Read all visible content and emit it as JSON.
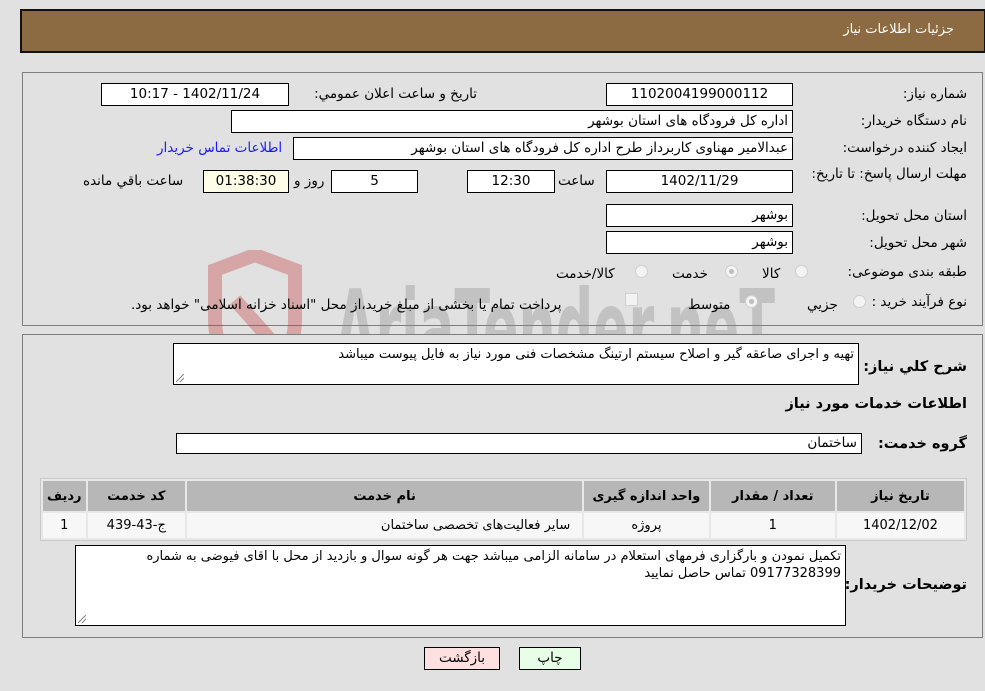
{
  "header": {
    "title": "جزئيات اطلاعات نياز"
  },
  "form": {
    "need_number": {
      "label": "شماره نياز:",
      "value": "1102004199000112"
    },
    "announce_datetime": {
      "label": "تاريخ و ساعت اعلان عمومي:",
      "value": "1402/11/24 - 10:17"
    },
    "buyer_org": {
      "label": "نام دستگاه خريدار:",
      "value": "اداره کل فرودگاه های استان بوشهر"
    },
    "requester": {
      "label": "ايجاد کننده درخواست:",
      "value": "عبدالامیر مهناوی کاربرداز طرح اداره کل فرودگاه های استان بوشهر"
    },
    "buyer_contact_link": "اطلاعات تماس خريدار",
    "deadline": {
      "label": "مهلت ارسال پاسخ: تا تاريخ:",
      "date": "1402/11/29",
      "time_label": "ساعت",
      "time": "12:30",
      "days": "5",
      "days_label": "روز و",
      "remaining": "01:38:30",
      "remaining_label": "ساعت باقي مانده"
    },
    "delivery_province": {
      "label": "استان محل تحويل:",
      "value": "بوشهر"
    },
    "delivery_city": {
      "label": "شهر محل تحويل:",
      "value": "بوشهر"
    },
    "category": {
      "label": "طبقه بندی موضوعی:",
      "options": [
        "کالا",
        "خدمت",
        "کالا/خدمت"
      ],
      "selected": "خدمت"
    },
    "purchase_type": {
      "label": "نوع فرآيند خريد :",
      "options": [
        "جزيي",
        "متوسط"
      ],
      "selected": "متوسط",
      "payment_note": "پرداخت تمام يا بخشی از مبلغ خريد،از محل \"اسناد خزانه اسلامی\" خواهد بود."
    }
  },
  "details": {
    "general_desc_label": "شرح کلي نياز:",
    "general_desc": "تهيه و اجرای صاعقه گير و اصلاح سيستم  ارتينگ مشخصات فنی مورد نياز به فايل پيوست ميباشد",
    "services_heading": "اطلاعات خدمات مورد نياز",
    "service_group_label": "گروه خدمت:",
    "service_group": "ساختمان",
    "table": {
      "headers": [
        "رديف",
        "کد خدمت",
        "نام خدمت",
        "واحد اندازه گيری",
        "تعداد / مقدار",
        "تاريخ نياز"
      ],
      "rows": [
        [
          "1",
          "ج-43-439",
          "ساير فعاليت‌های تخصصی ساختمان",
          "پروژه",
          "1",
          "1402/12/02"
        ]
      ]
    },
    "buyer_notes_label": "توضيحات خريدار:",
    "buyer_notes": "تکميل نمودن و بارگزاری فرمهای استعلام در سامانه الزامی ميباشد جهت هر گونه سوال و بازديد از محل با اقای فيوضی به شماره 09177328399 تماس حاصل نماييد"
  },
  "buttons": {
    "print": "چاپ",
    "back": "بازگشت"
  },
  "watermark": {
    "text": "AriaTender.neT"
  }
}
